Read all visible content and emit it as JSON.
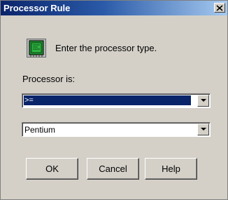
{
  "window": {
    "title": "Processor Rule",
    "close_glyph": "✕"
  },
  "dialog": {
    "icon": "processor-chip-icon",
    "prompt": "Enter the processor type.",
    "processor_label": "Processor is:",
    "operator_value": ">=",
    "processor_value": "Pentium"
  },
  "buttons": {
    "ok": "OK",
    "cancel": "Cancel",
    "help": "Help"
  },
  "colors": {
    "title_bar": "#0a246a",
    "dialog_bg": "#d4d0c8",
    "selection": "#0a246a",
    "chip_green": "#1f8a2e"
  }
}
